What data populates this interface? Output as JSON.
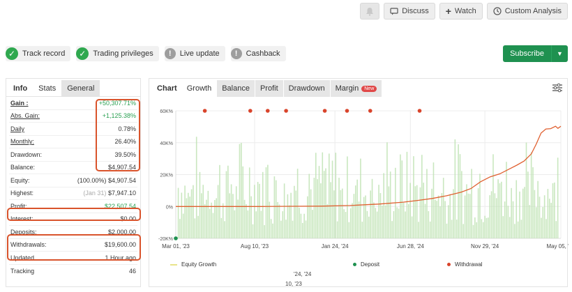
{
  "toolbar": {
    "discuss": "Discuss",
    "watch": "Watch",
    "custom_analysis": "Custom Analysis"
  },
  "status_chips": [
    {
      "label": "Track record",
      "state": "ok"
    },
    {
      "label": "Trading privileges",
      "state": "ok"
    },
    {
      "label": "Live update",
      "state": "na"
    },
    {
      "label": "Cashback",
      "state": "na"
    }
  ],
  "subscribe_label": "Subscribe",
  "left_tabs": [
    "Info",
    "Stats",
    "General"
  ],
  "stats": {
    "gain": {
      "label": "Gain :",
      "value": "+50,307.71%"
    },
    "abs_gain": {
      "label": "Abs. Gain:",
      "value": "+1,125.38%"
    },
    "daily": {
      "label": "Daily",
      "value": "0.78%"
    },
    "monthly": {
      "label": "Monthly:",
      "value": "26.40%"
    },
    "drawdown": {
      "label": "Drawdown:",
      "value": "39.50%"
    },
    "balance": {
      "label": "Balance:",
      "value": "$4,907.54"
    },
    "equity": {
      "label": "Equity:",
      "prefix": "(100.00%)",
      "value": "$4,907.54"
    },
    "highest": {
      "label": "Highest:",
      "prefix": "(Jan 31)",
      "value": "$7,947.10"
    },
    "profit": {
      "label": "Profit:",
      "value": "$22,507.54"
    },
    "interest": {
      "label": "Interest:",
      "value": "$0.00"
    },
    "deposits": {
      "label": "Deposits:",
      "value": "$2,000.00"
    },
    "withdrawals": {
      "label": "Withdrawals:",
      "value": "$19,600.00"
    },
    "updated": {
      "label": "Updated",
      "value": "1 Hour ago"
    },
    "tracking": {
      "label": "Tracking",
      "value": "46"
    }
  },
  "chart_tabs": {
    "chart": "Chart",
    "growth": "Growth",
    "balance": "Balance",
    "profit": "Profit",
    "drawdown": "Drawdown",
    "margin": "Margin",
    "new_badge": "New"
  },
  "ghost_labels": [
    "'24, '24",
    "10, '23"
  ],
  "chart_data": {
    "type": "line",
    "title": "",
    "ylim": [
      -20,
      60
    ],
    "y_ticks": [
      -20,
      0,
      20,
      40,
      60
    ],
    "y_tick_labels": [
      "-20K%",
      "0%",
      "20K%",
      "40K%",
      "60K%"
    ],
    "x_ticks": [
      0,
      163,
      329,
      485,
      639,
      796
    ],
    "x_tick_labels": [
      "Mar 01, '23",
      "Aug 10, '23",
      "Jan 24, '24",
      "Jun 28, '24",
      "Nov 29, '24",
      "May 05, '25"
    ],
    "grid": true,
    "legend": [
      {
        "name": "Equity Growth",
        "color": "#e8e48a"
      },
      {
        "name": "Deposit",
        "color": "#1f9150"
      },
      {
        "name": "Withdrawal",
        "color": "#d9442b"
      }
    ],
    "series": [
      {
        "name": "Equity Growth",
        "color": "#e06030",
        "x": [
          0,
          60,
          120,
          180,
          240,
          300,
          360,
          420,
          470,
          500,
          530,
          560,
          590,
          610,
          630,
          650,
          670,
          690,
          705,
          720,
          735,
          745,
          755,
          765,
          775,
          785,
          790,
          796
        ],
        "y": [
          0,
          0,
          0,
          0,
          0.1,
          0.2,
          0.6,
          1.5,
          2.7,
          3.8,
          5.0,
          6.7,
          9.0,
          11.2,
          15.5,
          18.6,
          20.5,
          23.6,
          25.9,
          28.5,
          33.0,
          39.0,
          46.0,
          48.6,
          48.8,
          50.3,
          49.0,
          50.3
        ]
      }
    ],
    "deposits": [
      {
        "x": 0,
        "y": -20
      }
    ],
    "withdrawals_x": [
      60,
      154,
      190,
      228,
      308,
      354,
      402,
      504
    ]
  }
}
